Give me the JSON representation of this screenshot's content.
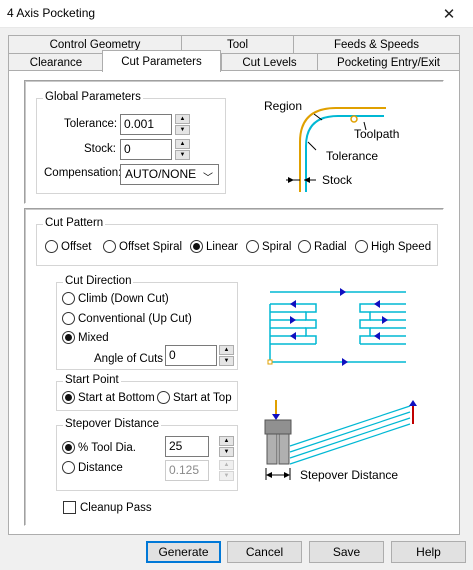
{
  "window": {
    "title": "4 Axis Pocketing",
    "close_glyph": "✕"
  },
  "tabs_back": [
    {
      "label": "Control Geometry"
    },
    {
      "label": "Tool"
    },
    {
      "label": "Feeds & Speeds"
    }
  ],
  "tabs_front": [
    {
      "label": "Clearance"
    },
    {
      "label": "Cut Parameters"
    },
    {
      "label": "Cut Levels"
    },
    {
      "label": "Pocketing Entry/Exit"
    }
  ],
  "active_tab": "Cut Parameters",
  "global_parameters": {
    "title": "Global Parameters",
    "tolerance_label": "Tolerance:",
    "tolerance_value": "0.001",
    "stock_label": "Stock:",
    "stock_value": "0",
    "compensation_label": "Compensation:",
    "compensation_value": "AUTO/NONE"
  },
  "diagram_top": {
    "region": "Region",
    "toolpath": "Toolpath",
    "tolerance": "Tolerance",
    "stock": "Stock"
  },
  "cut_pattern": {
    "title": "Cut Pattern",
    "options": [
      "Offset",
      "Offset Spiral",
      "Linear",
      "Spiral",
      "Radial",
      "High Speed"
    ],
    "selected": "Linear"
  },
  "cut_direction": {
    "title": "Cut Direction",
    "options": [
      "Climb (Down Cut)",
      "Conventional (Up Cut)",
      "Mixed"
    ],
    "selected": "Mixed",
    "angle_label": "Angle of Cuts",
    "angle_value": "0"
  },
  "start_point": {
    "title": "Start Point",
    "options": [
      "Start at Bottom",
      "Start at Top"
    ],
    "selected": "Start at Bottom"
  },
  "stepover": {
    "title": "Stepover Distance",
    "tool_dia_label": "% Tool Dia.",
    "tool_dia_value": "25",
    "distance_label": "Distance",
    "distance_value": "0.125",
    "selected": "% Tool Dia."
  },
  "diagram_bottom": {
    "stepover_label": "Stepover Distance"
  },
  "cleanup_pass": {
    "label": "Cleanup Pass",
    "checked": false
  },
  "buttons": {
    "generate": "Generate",
    "cancel": "Cancel",
    "save": "Save",
    "help": "Help"
  },
  "colors": {
    "toolpath": "#00b8d4",
    "region": "#e0a000",
    "arrow": "#1010c0",
    "accent": "#0078d7"
  }
}
